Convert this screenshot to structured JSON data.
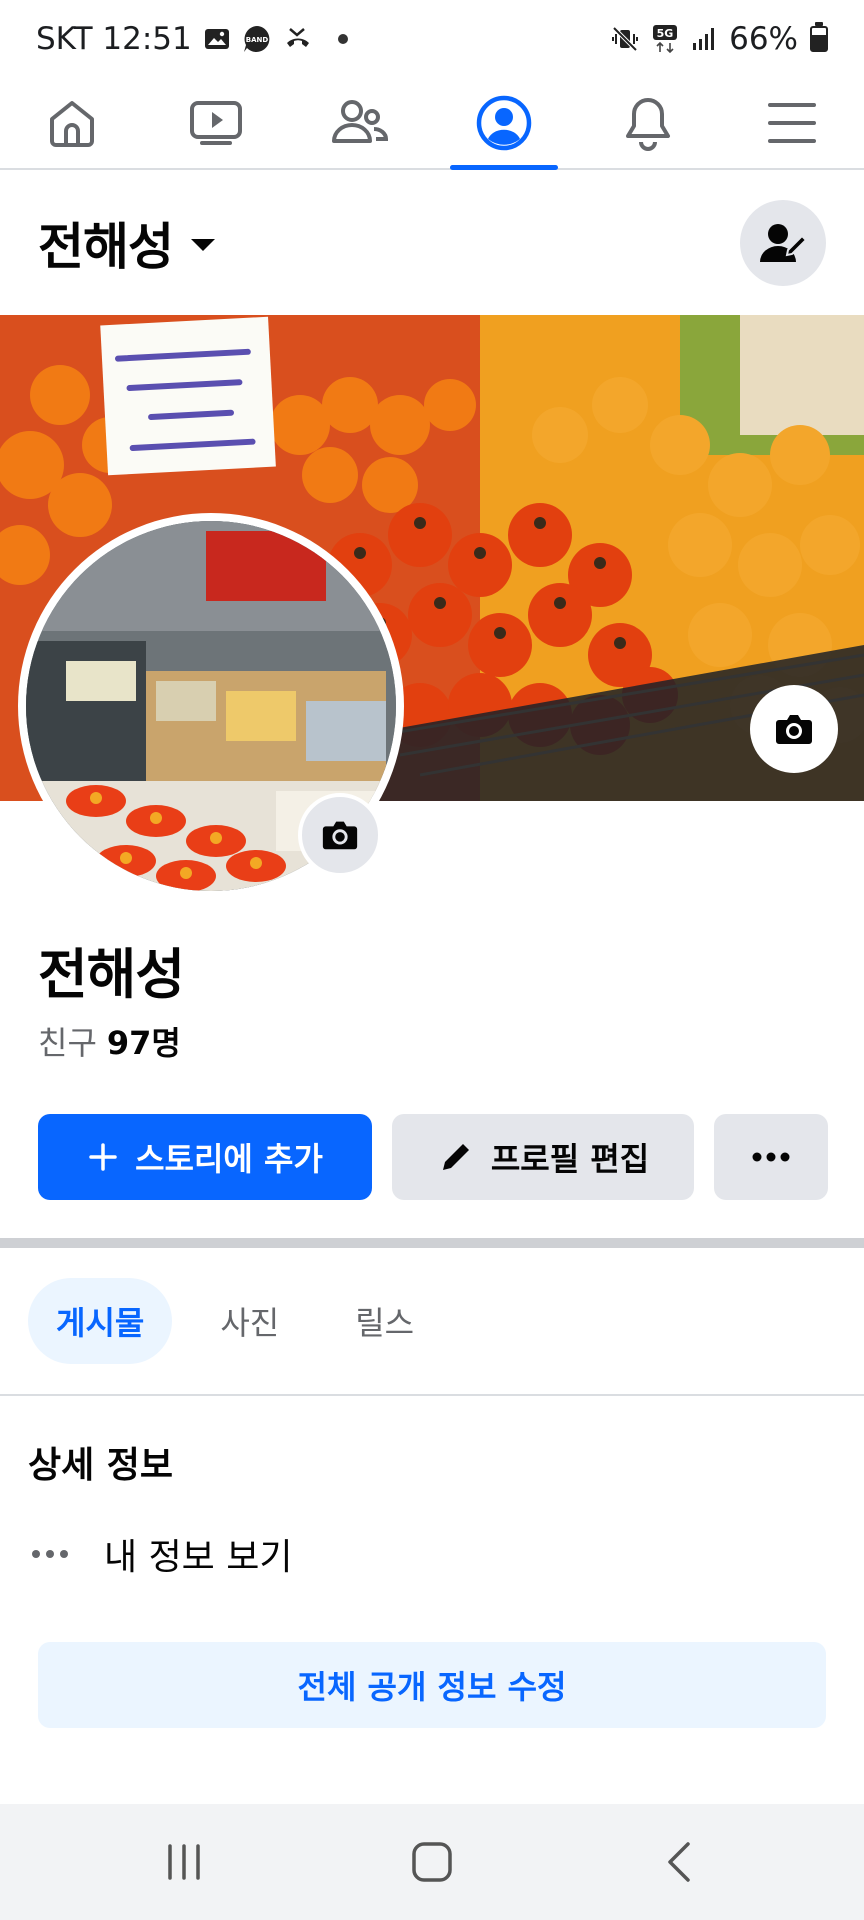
{
  "status_bar": {
    "carrier_time": "SKT 12:51",
    "network": "5G",
    "battery": "66%",
    "battery_level": 0.66,
    "icons": [
      "gallery-icon",
      "band-icon",
      "missed-call-icon",
      "notification-dot-icon",
      "mute-vibrate-icon",
      "5g-icon",
      "signal-icon",
      "battery-icon"
    ]
  },
  "top_nav": {
    "tabs": [
      {
        "icon": "home-icon",
        "active": false
      },
      {
        "icon": "video-icon",
        "active": false
      },
      {
        "icon": "friends-icon",
        "active": false
      },
      {
        "icon": "profile-icon",
        "active": true
      },
      {
        "icon": "bell-icon",
        "active": false
      },
      {
        "icon": "menu-icon",
        "active": false
      }
    ]
  },
  "header": {
    "name": "전해성",
    "dropdown_icon": "caret-down-icon",
    "action_icon": "edit-profile-person-icon"
  },
  "cover": {
    "description_icon": "camera-icon"
  },
  "profile": {
    "name": "전해성",
    "friends_label": "친구",
    "friends_count": "97명"
  },
  "actions": {
    "add_story": "스토리에 추가",
    "add_story_icon": "plus-icon",
    "edit_profile": "프로필 편집",
    "edit_profile_icon": "pencil-icon",
    "more_icon": "more-horizontal-icon"
  },
  "tabs": [
    {
      "label": "게시물",
      "active": true
    },
    {
      "label": "사진",
      "active": false
    },
    {
      "label": "릴스",
      "active": false
    }
  ],
  "details": {
    "title": "상세 정보",
    "see_info": "내 정보 보기",
    "edit_public": "전체 공개 정보 수정"
  },
  "colors": {
    "accent": "#0866ff",
    "accent_light": "#ebf5ff",
    "secondary_bg": "#e4e6eb",
    "text": "#050505",
    "muted": "#65676b"
  },
  "system_nav": [
    "recent-apps-icon",
    "home-button-icon",
    "back-icon"
  ]
}
